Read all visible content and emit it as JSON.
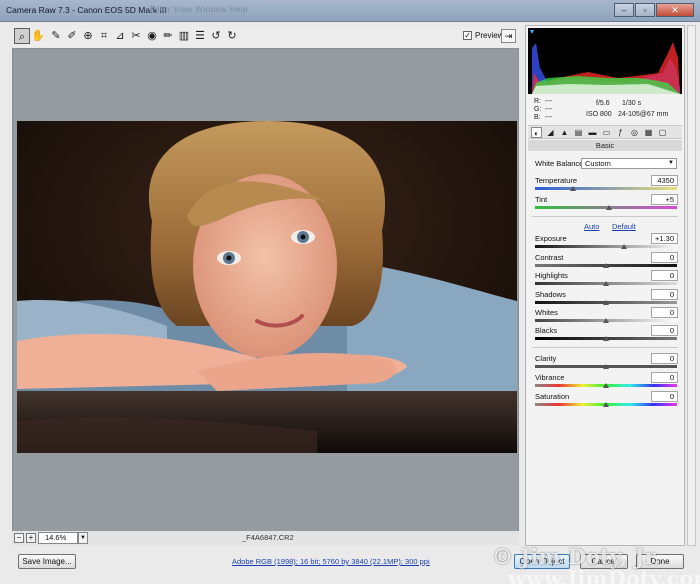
{
  "window": {
    "title": "Camera Raw 7.3  -  Canon EOS 5D Mark III",
    "menu_ghost": "Filter   View   Window   Help"
  },
  "toolbar": {
    "tools": [
      "zoom-icon",
      "hand-icon",
      "white-balance-icon",
      "color-sampler-icon",
      "targeted-adjust-icon",
      "crop-icon",
      "straighten-icon",
      "spot-removal-icon",
      "red-eye-icon",
      "adjustment-brush-icon",
      "graduated-filter-icon",
      "list-icon",
      "rotate-ccw-icon",
      "rotate-cw-icon"
    ],
    "preview_label": "Preview",
    "preview_checked": true
  },
  "bottom": {
    "zoom_value": "14.6%",
    "filename": "_F4A6847.CR2"
  },
  "footer": {
    "save_label": "Save Image...",
    "workflow_link": "Adobe RGB (1998); 16 bit; 5760 by 3840 (22.1MP); 300 ppi",
    "open_label": "Open Object",
    "cancel_label": "Cancel",
    "done_label": "Done"
  },
  "watermark": {
    "line1": "© Jim Doty, Jr.",
    "line2": "www.JimDoty.com"
  },
  "readout": {
    "r": "R:",
    "g": "G:",
    "b": "B:",
    "dash": "---",
    "aperture": "f/5.6",
    "shutter": "1/30 s",
    "iso": "ISO 800",
    "lens": "24-105@67 mm"
  },
  "panel": {
    "title": "Basic",
    "wb_label": "White Balance:",
    "wb_value": "Custom",
    "auto": "Auto",
    "default": "Default",
    "temperature": {
      "label": "Temperature",
      "value": "4350",
      "level": 0.27
    },
    "tint": {
      "label": "Tint",
      "value": "+5",
      "level": 0.52
    },
    "exposure": {
      "label": "Exposure",
      "value": "+1.30",
      "level": 0.63
    },
    "contrast": {
      "label": "Contrast",
      "value": "0",
      "level": 0.5
    },
    "highlights": {
      "label": "Highlights",
      "value": "0",
      "level": 0.5
    },
    "shadows": {
      "label": "Shadows",
      "value": "0",
      "level": 0.5
    },
    "whites": {
      "label": "Whites",
      "value": "0",
      "level": 0.5
    },
    "blacks": {
      "label": "Blacks",
      "value": "0",
      "level": 0.5
    },
    "clarity": {
      "label": "Clarity",
      "value": "0",
      "level": 0.5
    },
    "vibrance": {
      "label": "Vibrance",
      "value": "0",
      "level": 0.5
    },
    "saturation": {
      "label": "Saturation",
      "value": "0",
      "level": 0.5
    }
  },
  "colors": {
    "accent": "#3a78b5",
    "canvas": "#969b9f"
  }
}
